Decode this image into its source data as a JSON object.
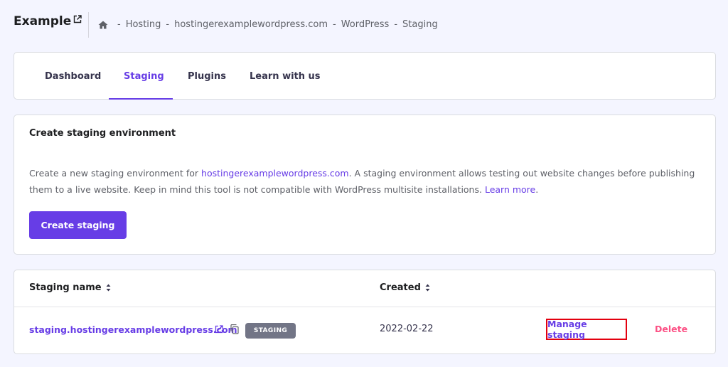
{
  "header": {
    "site_title": "Example",
    "breadcrumb": [
      "Hosting",
      "hostingerexamplewordpress.com",
      "WordPress",
      "Staging"
    ],
    "breadcrumb_separator": "-"
  },
  "tabs": [
    {
      "label": "Dashboard",
      "active": false
    },
    {
      "label": "Staging",
      "active": true
    },
    {
      "label": "Plugins",
      "active": false
    },
    {
      "label": "Learn with us",
      "active": false
    }
  ],
  "create_section": {
    "title": "Create staging environment",
    "desc_part1": "Create a new staging environment for ",
    "desc_domain": "hostingerexamplewordpress.com",
    "desc_part2": ". A staging environment allows testing out website changes before publishing them to a live website. Keep in mind this tool is not compatible with WordPress multisite installations. ",
    "learn_more": "Learn more",
    "desc_end": ".",
    "button_label": "Create staging"
  },
  "table": {
    "columns": [
      "Staging name",
      "Created"
    ],
    "rows": [
      {
        "name": "staging.hostingerexamplewordpress.com",
        "badge": "STAGING",
        "created": "2022-02-22",
        "manage_label": "Manage staging",
        "delete_label": "Delete"
      }
    ]
  },
  "colors": {
    "accent": "#673de6",
    "delete": "#fc5185",
    "highlight_border": "#e3000f",
    "badge_bg": "#727586"
  },
  "icons": [
    "external-link-icon",
    "home-icon",
    "sort-icon",
    "copy-icon"
  ]
}
